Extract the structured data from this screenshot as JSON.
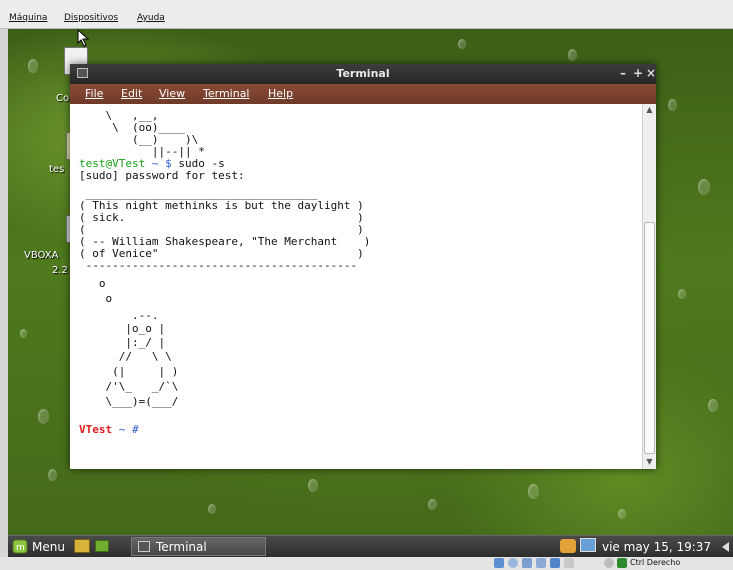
{
  "host_menu": [
    "Máquina",
    "Dispositivos",
    "Ayuda"
  ],
  "desktop_icons": [
    {
      "label": "Co"
    },
    {
      "label": "tes"
    },
    {
      "label": "VBOXA"
    },
    {
      "label": "2.2"
    }
  ],
  "terminal": {
    "title": "Terminal",
    "controls": {
      "minimize": "–",
      "maximize": "+",
      "close": "×"
    },
    "menu": [
      "File",
      "Edit",
      "View",
      "Terminal",
      "Help"
    ],
    "lines": [
      "    \\   ,__,",
      "     \\  (oo)____",
      "        (__)    )\\",
      "           ||--|| *",
      "[sudo] password for test:",
      " ___________________________________",
      "( This night methinks is but the daylight )",
      "( sick.                                   )",
      "(                                         )",
      "( -- William Shakespeare, \"The Merchant    )",
      "( of Venice\"                              )",
      " -----------------------------------------",
      "   o",
      "    o",
      "        .--.",
      "       |o_o |",
      "       |:_/ |",
      "      //   \\ \\",
      "     (|     | )",
      "    /'\\_   _/`\\",
      "    \\___)=(___/"
    ],
    "prompt1": {
      "user": "test@VTest",
      "path": " ~ $",
      "cmd": " sudo -s"
    },
    "prompt2": {
      "host": "VTest",
      "path": " ~ #"
    }
  },
  "taskbar": {
    "menu_label": "Menu",
    "window_button": "Terminal",
    "clock": "vie may 15, 19:37"
  },
  "status": {
    "hostkey": "Ctrl Derecho"
  }
}
